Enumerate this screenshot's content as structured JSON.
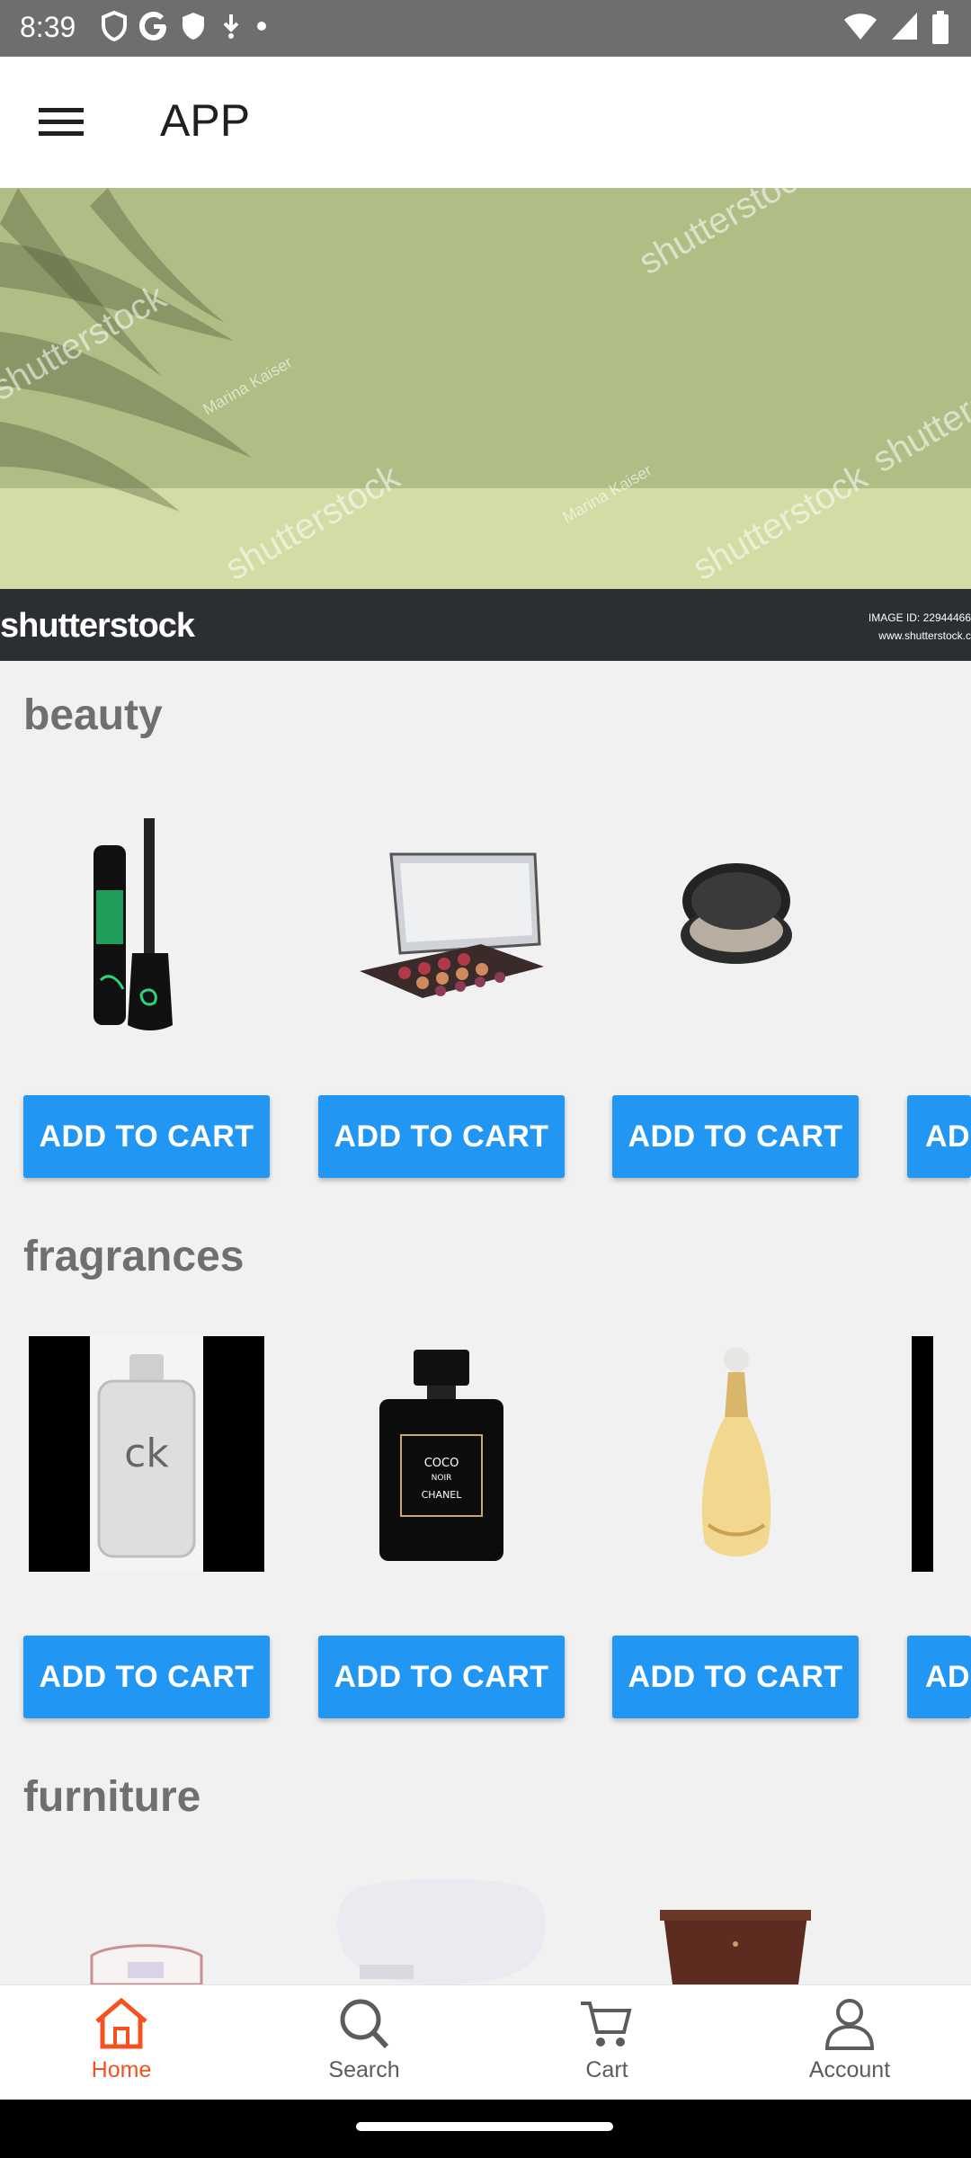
{
  "status_bar": {
    "time": "8:39"
  },
  "app_bar": {
    "title": "APP"
  },
  "hero": {
    "logo_text": "shutterstock",
    "image_id": "IMAGE ID: 22944466",
    "site": "www.shutterstock.c",
    "watermark": "shutterstock",
    "author": "Marina Kaiser"
  },
  "sections": [
    {
      "title": "beauty",
      "add_label": "ADD TO CART"
    },
    {
      "title": "fragrances",
      "add_label": "ADD TO CART"
    },
    {
      "title": "furniture"
    }
  ],
  "partial_button_label": "AD",
  "bottom_nav": {
    "items": [
      {
        "label": "Home",
        "icon": "home-icon"
      },
      {
        "label": "Search",
        "icon": "search-icon"
      },
      {
        "label": "Cart",
        "icon": "cart-icon"
      },
      {
        "label": "Account",
        "icon": "account-icon"
      }
    ]
  },
  "colors": {
    "accent": "#2196f3",
    "nav_active": "#f4511e",
    "status_bar": "#6e6e6e"
  }
}
